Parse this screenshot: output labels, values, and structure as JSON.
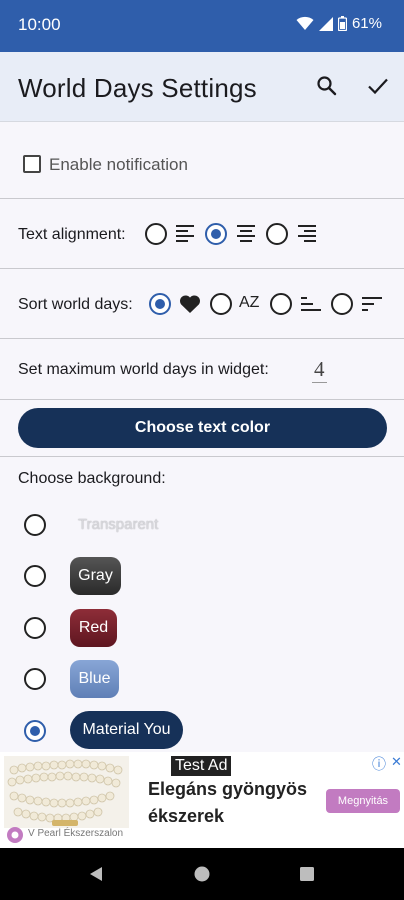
{
  "status_bar": {
    "time": "10:00",
    "battery": "61%"
  },
  "app_bar": {
    "title": "World Days Settings"
  },
  "notification": {
    "label": "Enable notification",
    "checked": false
  },
  "text_alignment": {
    "label": "Text alignment:",
    "selected": "center"
  },
  "sort": {
    "label": "Sort world days:",
    "selected": "favorite",
    "az_label": "AZ"
  },
  "max_days": {
    "label": "Set maximum world days in widget:",
    "value": "4"
  },
  "text_color_button": {
    "label": "Choose text color"
  },
  "background": {
    "label": "Choose background:",
    "options": [
      {
        "label": "Transparent",
        "selected": false,
        "color": "transparent"
      },
      {
        "label": "Gray",
        "selected": false,
        "color": "#3d3d3d"
      },
      {
        "label": "Red",
        "selected": false,
        "color": "#7a1f2a"
      },
      {
        "label": "Blue",
        "selected": false,
        "color": "#6f8fc2"
      },
      {
        "label": "Material You",
        "selected": true,
        "color": "#163158"
      }
    ]
  },
  "ad": {
    "tag": "Test Ad",
    "headline": "Elegáns gyöngyös ékszerek",
    "cta": "Megnyitás",
    "brand": "V Pearl Ékszerszalon"
  },
  "colors": {
    "accent": "#2f5eab",
    "primary_dark": "#163158",
    "status_bar": "#2f5eab"
  }
}
